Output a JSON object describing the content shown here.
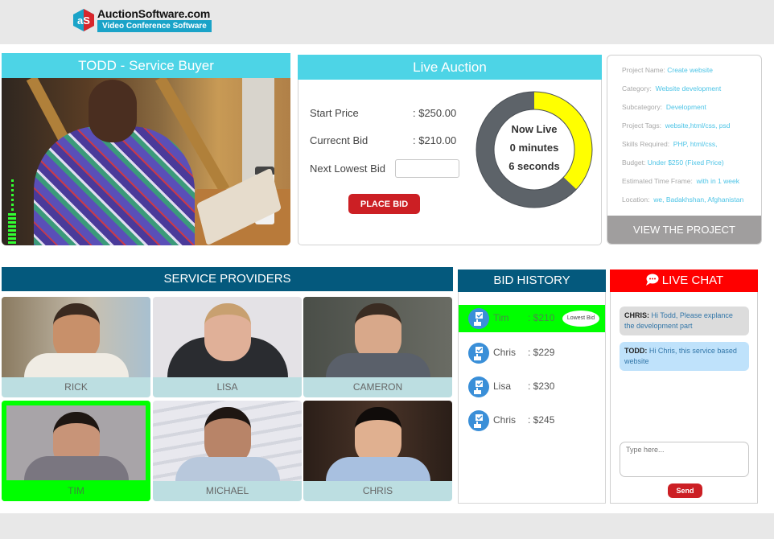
{
  "brand": {
    "logo_glyph": "aS",
    "title": "AuctionSoftware.com",
    "subtitle": "Video Conference Software"
  },
  "buyer": {
    "title": "TODD - Service Buyer",
    "audio_level": 0.6
  },
  "auction": {
    "title": "Live Auction",
    "start_price_label": "Start Price",
    "start_price_value": ": $250.00",
    "current_bid_label": "Currecnt Bid",
    "current_bid_value": ": $210.00",
    "next_bid_label": "Next Lowest Bid",
    "next_bid_value": "",
    "place_bid_label": "PLACE BID",
    "timer": {
      "line1": "Now Live",
      "line2": "0 minutes",
      "line3": "6 seconds",
      "progress": 0.37
    },
    "colors": {
      "ring_fill": "#ffff00",
      "ring_track": "#5d6369"
    }
  },
  "project": {
    "fields": [
      {
        "label": "Project Name:",
        "value": "Create website"
      },
      {
        "label": "Category:",
        "value": "Website development"
      },
      {
        "label": "Subcategory:",
        "value": "Development"
      },
      {
        "label": "Project Tags:",
        "value": "website,html/css, psd"
      },
      {
        "label": "Skills Required:",
        "value": "PHP, html/css,"
      },
      {
        "label": "Budget:",
        "value": "Under $250 (Fixed Price)"
      },
      {
        "label": "Estimated Time Frame:",
        "value": "with in 1 week"
      },
      {
        "label": "Location:",
        "value": "we, Badakhshan, Afghanistan"
      }
    ],
    "view_button": "VIEW THE PROJECT"
  },
  "providers": {
    "title": "SERVICE PROVIDERS",
    "items": [
      {
        "name": "RICK",
        "active": false
      },
      {
        "name": "LISA",
        "active": false
      },
      {
        "name": "CAMERON",
        "active": false
      },
      {
        "name": "TIM",
        "active": true
      },
      {
        "name": "MICHAEL",
        "active": false
      },
      {
        "name": "CHRIS",
        "active": false
      }
    ]
  },
  "bid_history": {
    "title": "BID HISTORY",
    "lowest_badge": "Lowest Bid",
    "rows": [
      {
        "name": "Tim",
        "amount": ": $210",
        "lowest": true
      },
      {
        "name": "Chris",
        "amount": ": $229",
        "lowest": false
      },
      {
        "name": "Lisa",
        "amount": ": $230",
        "lowest": false
      },
      {
        "name": "Chris",
        "amount": ": $245",
        "lowest": false
      }
    ]
  },
  "chat": {
    "title": "LIVE CHAT",
    "messages": [
      {
        "sender": "CHRIS:",
        "text": "Hi Todd, Please explance the development part"
      },
      {
        "sender": "TODD:",
        "text": "Hi Chris, this service based website"
      }
    ],
    "input_placeholder": "Type here...",
    "send_label": "Send"
  }
}
